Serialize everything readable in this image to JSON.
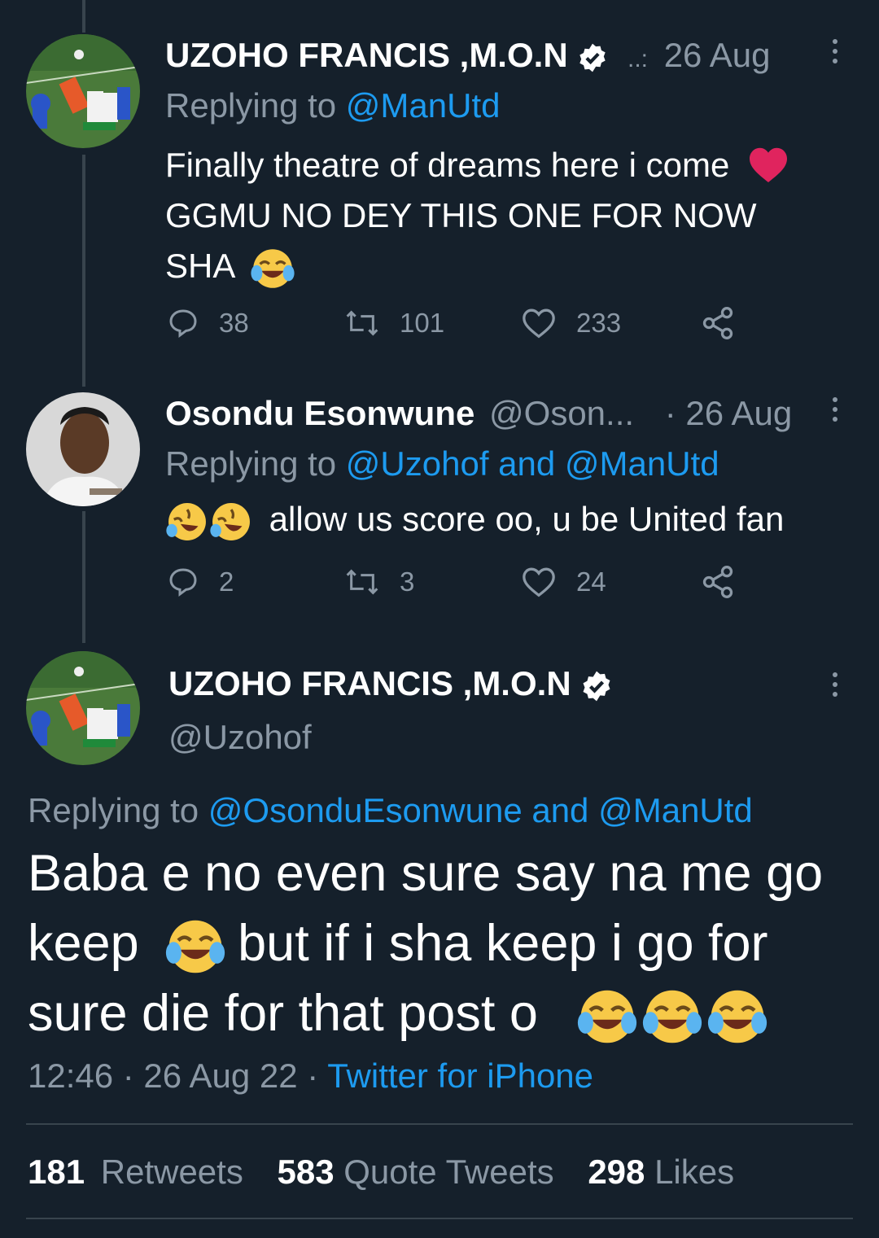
{
  "tweets": [
    {
      "name": "UZOHO FRANCIS ,M.O.N",
      "handle": "..:",
      "date": "26 Aug",
      "replying_prefix": "Replying to",
      "replying_to": "@ManUtd",
      "text_line1": "Finally theatre of dreams here i come",
      "text_line2": "GGMU NO DEY THIS ONE FOR NOW",
      "text_line3": "SHA",
      "replies": "38",
      "retweets": "101",
      "likes": "233"
    },
    {
      "name": "Osondu Esonwune",
      "handle": "@Oson...",
      "date": "· 26 Aug",
      "replying_prefix": "Replying to",
      "replying_to": "@Uzohof and @ManUtd",
      "text": "allow us score oo, u be United fan",
      "replies": "2",
      "retweets": "3",
      "likes": "24"
    }
  ],
  "main_tweet": {
    "name": "UZOHO FRANCIS ,M.O.N",
    "handle": "@Uzohof",
    "replying_prefix": "Replying to",
    "replying_to": "@OsonduEsonwune and @ManUtd",
    "text_line1": "Baba e no even sure say na me go",
    "text_line2a": "keep",
    "text_line2b": "but if i sha keep i go for",
    "text_line3": "sure die for that post o",
    "time": "12:46 · 26 Aug 22 ·",
    "source": "Twitter for iPhone"
  },
  "stats": {
    "retweets_count": "181",
    "retweets_label": "Retweets",
    "quotes_count": "583",
    "quotes_label": "Quote Tweets",
    "likes_count": "298",
    "likes_label": "Likes"
  },
  "colors": {
    "background": "#15202b",
    "muted": "#8b98a5",
    "link": "#1d9bf0",
    "heart": "#e0245e"
  }
}
